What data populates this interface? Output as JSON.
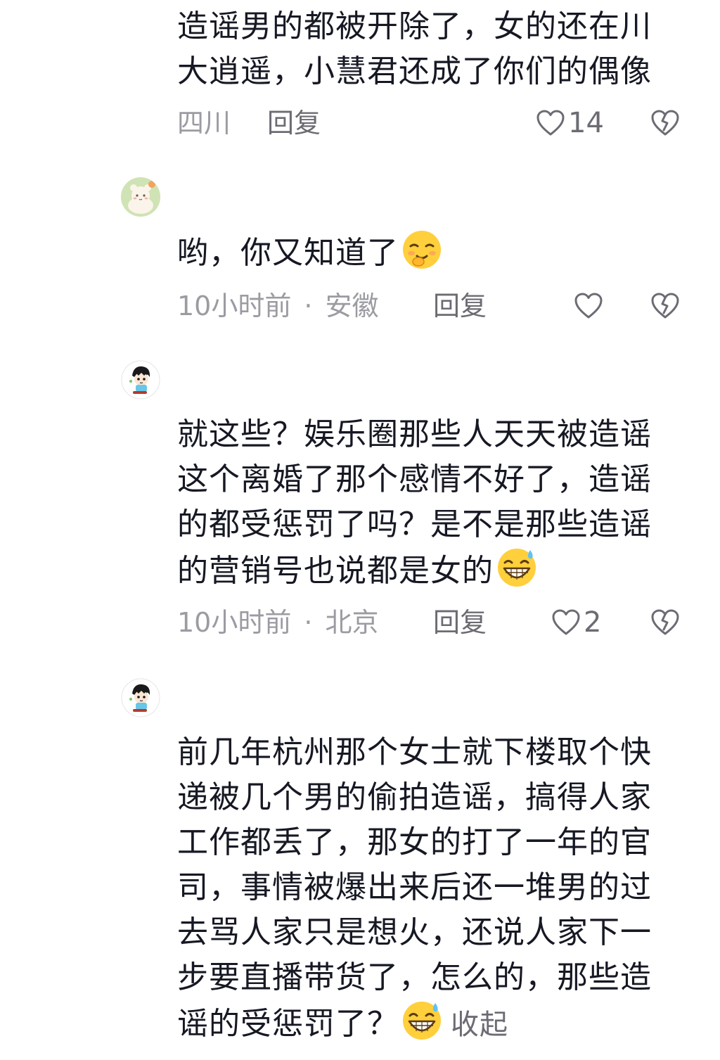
{
  "comments": [
    {
      "text_lines": [
        "造谣男的都被开除了，女的还在川",
        "大逍遥，小慧君还成了你们的偶像"
      ],
      "time": "",
      "location": "四川",
      "reply_label": "回复",
      "like_count": "14",
      "avatar": "none"
    },
    {
      "text": "哟，你又知道了",
      "emoji": "smirk-emoji",
      "time": "10小时前",
      "separator": "·",
      "location": "安徽",
      "reply_label": "回复",
      "like_count": "",
      "avatar": "plush-toy-avatar"
    },
    {
      "text_lines": [
        "就这些？娱乐圈那些人天天被造谣",
        "这个离婚了那个感情不好了，造谣",
        "的都受惩罚了吗？是不是那些造谣",
        "的营销号也说都是女的"
      ],
      "emoji": "grin-sweat-emoji",
      "time": "10小时前",
      "separator": "·",
      "location": "北京",
      "reply_label": "回复",
      "like_count": "2",
      "avatar": "cartoon-boy-avatar"
    },
    {
      "text_lines": [
        "前几年杭州那个女士就下楼取个快",
        "递被几个男的偷拍造谣，搞得人家",
        "工作都丢了，那女的打了一年的官",
        "司，事情被爆出来后还一堆男的过",
        "去骂人家只是想火，还说人家下一",
        "步要直播带货了，怎么的，那些造",
        "谣的受惩罚了？"
      ],
      "emoji": "grin-sweat-emoji",
      "collapse_label": "收起",
      "avatar": "cartoon-boy-avatar"
    }
  ],
  "colors": {
    "text": "#161823",
    "meta": "#9b9ca2",
    "action": "#6b6c73"
  }
}
